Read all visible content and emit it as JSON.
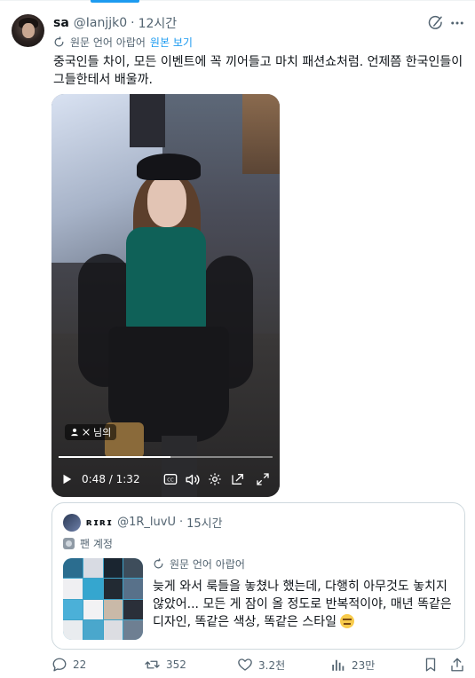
{
  "tweet": {
    "author_name": "sa",
    "handle": "@Ianjjk0",
    "separator": "·",
    "time": "12시간",
    "translate_note": "원문 언어 아랍어",
    "show_original": "원본 보기",
    "text": "중국인들 차이, 모든 이벤트에 꼭 끼어들고 마치 패션쇼처럼. 언제쯤 한국인들이 그들한테서 배울까."
  },
  "video": {
    "watermark": "님의",
    "current_time": "0:48",
    "time_separator": " / ",
    "duration": "1:32",
    "progress_fraction": 0.522
  },
  "quote": {
    "author_name": "ʀɪʀɪ",
    "handle": "@1R_luvU",
    "separator": "·",
    "time": "15시간",
    "account_label": "팬 계정",
    "translate_note": "원문 언어 아랍어",
    "text": "늦게 와서 룩들을 놓쳤나 했는데, 다행히 아무것도 놓치지 않았어... 모든 게 잠이 올 정도로 반복적이야, 매년 똑같은 디자인, 똑같은 색상, 똑같은 스타일"
  },
  "actions": {
    "replies": "22",
    "reposts": "352",
    "likes": "3.2천",
    "views": "23만"
  },
  "icons": {
    "grok": "grok-icon",
    "more": "more-icon",
    "translate": "translate-icon",
    "play": "play-icon",
    "cc": "closed-captions-icon",
    "volume": "volume-icon",
    "settings": "settings-icon",
    "pip": "picture-in-picture-icon",
    "fullscreen": "fullscreen-icon",
    "reply": "reply-icon",
    "repost": "repost-icon",
    "like": "like-icon",
    "views": "views-icon",
    "bookmark": "bookmark-icon",
    "share": "share-icon"
  },
  "colors": {
    "accent": "#1d9bf0",
    "text": "#0f1419",
    "muted": "#536471",
    "border": "#cfd9de"
  }
}
